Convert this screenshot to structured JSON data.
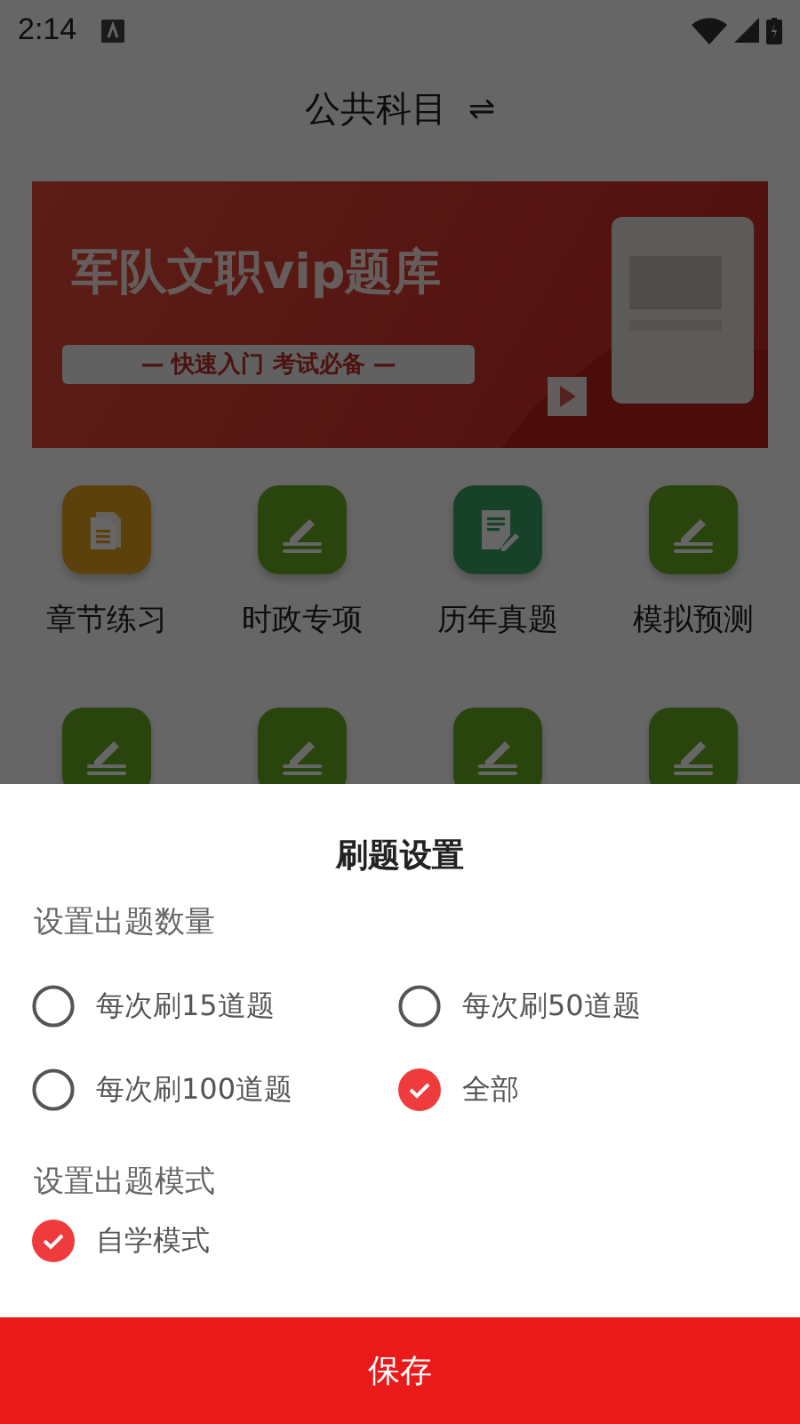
{
  "status_bar": {
    "time": "2:14"
  },
  "header": {
    "title": "公共科目",
    "switch_glyph": "⇌"
  },
  "banner": {
    "title": "军队文职vip题库",
    "subtitle": "— 快速入门  考试必备 —"
  },
  "tiles": [
    {
      "kind": "doc",
      "label": "章节练习"
    },
    {
      "kind": "pen",
      "label": "时政专项"
    },
    {
      "kind": "note",
      "label": "历年真题"
    },
    {
      "kind": "pen",
      "label": "模拟预测"
    },
    {
      "kind": "pen"
    },
    {
      "kind": "pen"
    },
    {
      "kind": "pen"
    },
    {
      "kind": "pen"
    }
  ],
  "sheet": {
    "title": "刷题设置",
    "sections": [
      {
        "label": "设置出题数量",
        "options": [
          {
            "label": "每次刷15道题",
            "selected": false
          },
          {
            "label": "每次刷50道题",
            "selected": false
          },
          {
            "label": "每次刷100道题",
            "selected": false
          },
          {
            "label": "全部",
            "selected": true
          }
        ]
      },
      {
        "label": "设置出题模式",
        "options": [
          {
            "label": "自学模式",
            "selected": true
          }
        ]
      }
    ],
    "save_button": "保存"
  }
}
